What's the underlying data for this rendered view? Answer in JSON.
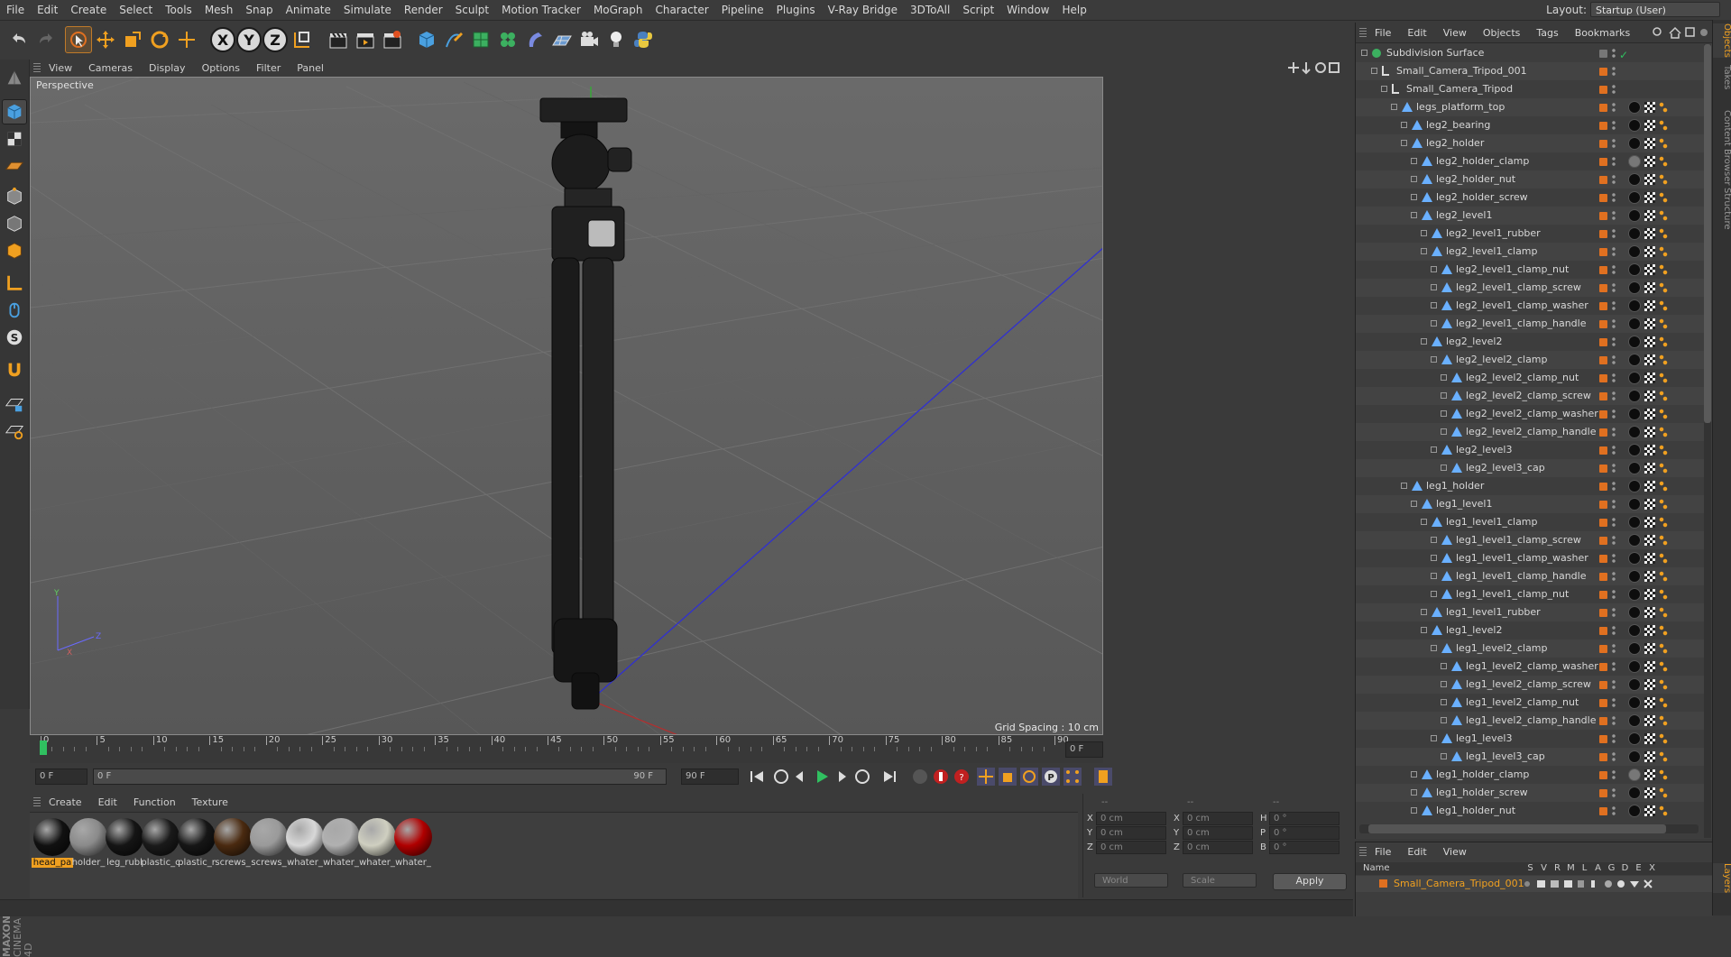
{
  "menubar": {
    "items": [
      "File",
      "Edit",
      "Create",
      "Select",
      "Tools",
      "Mesh",
      "Snap",
      "Animate",
      "Simulate",
      "Render",
      "Sculpt",
      "Motion Tracker",
      "MoGraph",
      "Character",
      "Pipeline",
      "Plugins",
      "V-Ray Bridge",
      "3DToAll",
      "Script",
      "Window",
      "Help"
    ],
    "layout_label": "Layout:",
    "layout_value": "Startup (User)"
  },
  "toolbar": {
    "axis_x": "X",
    "axis_y": "Y",
    "axis_z": "Z"
  },
  "viewport": {
    "menu": [
      "View",
      "Cameras",
      "Display",
      "Options",
      "Filter",
      "Panel"
    ],
    "label": "Perspective",
    "grid_spacing": "Grid Spacing : 10 cm",
    "axis_x": "X",
    "axis_y": "Y",
    "axis_z": "Z"
  },
  "timeline": {
    "ticks": [
      "0",
      "5",
      "10",
      "15",
      "20",
      "25",
      "30",
      "35",
      "40",
      "45",
      "50",
      "55",
      "60",
      "65",
      "70",
      "75",
      "80",
      "85",
      "90"
    ],
    "current_frame": "0 F",
    "start_field": "0 F",
    "range_start": "0 F",
    "range_end": "90 F",
    "end_field": "90 F"
  },
  "materials": {
    "menu": [
      "Create",
      "Edit",
      "Function",
      "Texture"
    ],
    "items": [
      {
        "name": "head_pa",
        "color": "#111111",
        "active": true
      },
      {
        "name": "holder_",
        "color": "#8a8a8a",
        "active": false
      },
      {
        "name": "leg_rubl",
        "color": "#151515",
        "active": false
      },
      {
        "name": "plastic_c",
        "color": "#1a1a1a",
        "active": false
      },
      {
        "name": "plastic_r",
        "color": "#161616",
        "active": false
      },
      {
        "name": "screws_",
        "color": "#4a2a10",
        "active": false
      },
      {
        "name": "screws_",
        "color": "#9a9a9a",
        "active": false
      },
      {
        "name": "whater_",
        "color": "#d8d8d8",
        "active": false
      },
      {
        "name": "whater_",
        "color": "#b0b0b0",
        "active": false
      },
      {
        "name": "whater_",
        "color": "#cfcfc0",
        "active": false
      },
      {
        "name": "whater_",
        "color": "#b00000",
        "active": false
      }
    ]
  },
  "coordinates": {
    "header1": "--",
    "header2": "--",
    "header3": "--",
    "rows": [
      {
        "l1": "X",
        "v1": "0 cm",
        "l2": "X",
        "v2": "0 cm",
        "l3": "H",
        "v3": "0 °"
      },
      {
        "l1": "Y",
        "v1": "0 cm",
        "l2": "Y",
        "v2": "0 cm",
        "l3": "P",
        "v3": "0 °"
      },
      {
        "l1": "Z",
        "v1": "0 cm",
        "l2": "Z",
        "v2": "0 cm",
        "l3": "B",
        "v3": "0 °"
      }
    ],
    "mode": "World",
    "scale": "Scale",
    "apply": "Apply"
  },
  "object_manager": {
    "menu": [
      "File",
      "Edit",
      "View",
      "Objects",
      "Tags",
      "Bookmarks"
    ],
    "objects": [
      {
        "name": "Subdivision Surface",
        "depth": 0,
        "type": "subdiv"
      },
      {
        "name": "Small_Camera_Tripod_001",
        "depth": 1,
        "type": "null"
      },
      {
        "name": "Small_Camera_Tripod",
        "depth": 2,
        "type": "null"
      },
      {
        "name": "legs_platform_top",
        "depth": 3,
        "type": "poly"
      },
      {
        "name": "leg2_bearing",
        "depth": 4,
        "type": "poly"
      },
      {
        "name": "leg2_holder",
        "depth": 4,
        "type": "poly"
      },
      {
        "name": "leg2_holder_clamp",
        "depth": 5,
        "type": "poly"
      },
      {
        "name": "leg2_holder_nut",
        "depth": 5,
        "type": "poly"
      },
      {
        "name": "leg2_holder_screw",
        "depth": 5,
        "type": "poly"
      },
      {
        "name": "leg2_level1",
        "depth": 5,
        "type": "poly"
      },
      {
        "name": "leg2_level1_rubber",
        "depth": 6,
        "type": "poly"
      },
      {
        "name": "leg2_level1_clamp",
        "depth": 6,
        "type": "poly"
      },
      {
        "name": "leg2_level1_clamp_nut",
        "depth": 7,
        "type": "poly"
      },
      {
        "name": "leg2_level1_clamp_screw",
        "depth": 7,
        "type": "poly"
      },
      {
        "name": "leg2_level1_clamp_washer",
        "depth": 7,
        "type": "poly"
      },
      {
        "name": "leg2_level1_clamp_handle",
        "depth": 7,
        "type": "poly"
      },
      {
        "name": "leg2_level2",
        "depth": 6,
        "type": "poly"
      },
      {
        "name": "leg2_level2_clamp",
        "depth": 7,
        "type": "poly"
      },
      {
        "name": "leg2_level2_clamp_nut",
        "depth": 8,
        "type": "poly"
      },
      {
        "name": "leg2_level2_clamp_screw",
        "depth": 8,
        "type": "poly"
      },
      {
        "name": "leg2_level2_clamp_washer",
        "depth": 8,
        "type": "poly"
      },
      {
        "name": "leg2_level2_clamp_handle",
        "depth": 8,
        "type": "poly"
      },
      {
        "name": "leg2_level3",
        "depth": 7,
        "type": "poly"
      },
      {
        "name": "leg2_level3_cap",
        "depth": 8,
        "type": "poly"
      },
      {
        "name": "leg1_holder",
        "depth": 4,
        "type": "poly"
      },
      {
        "name": "leg1_level1",
        "depth": 5,
        "type": "poly"
      },
      {
        "name": "leg1_level1_clamp",
        "depth": 6,
        "type": "poly"
      },
      {
        "name": "leg1_level1_clamp_screw",
        "depth": 7,
        "type": "poly"
      },
      {
        "name": "leg1_level1_clamp_washer",
        "depth": 7,
        "type": "poly"
      },
      {
        "name": "leg1_level1_clamp_handle",
        "depth": 7,
        "type": "poly"
      },
      {
        "name": "leg1_level1_clamp_nut",
        "depth": 7,
        "type": "poly"
      },
      {
        "name": "leg1_level1_rubber",
        "depth": 6,
        "type": "poly"
      },
      {
        "name": "leg1_level2",
        "depth": 6,
        "type": "poly"
      },
      {
        "name": "leg1_level2_clamp",
        "depth": 7,
        "type": "poly"
      },
      {
        "name": "leg1_level2_clamp_washer",
        "depth": 8,
        "type": "poly"
      },
      {
        "name": "leg1_level2_clamp_screw",
        "depth": 8,
        "type": "poly"
      },
      {
        "name": "leg1_level2_clamp_nut",
        "depth": 8,
        "type": "poly"
      },
      {
        "name": "leg1_level2_clamp_handle",
        "depth": 8,
        "type": "poly"
      },
      {
        "name": "leg1_level3",
        "depth": 7,
        "type": "poly"
      },
      {
        "name": "leg1_level3_cap",
        "depth": 8,
        "type": "poly"
      },
      {
        "name": "leg1_holder_clamp",
        "depth": 5,
        "type": "poly"
      },
      {
        "name": "leg1_holder_screw",
        "depth": 5,
        "type": "poly"
      },
      {
        "name": "leg1_holder_nut",
        "depth": 5,
        "type": "poly"
      }
    ]
  },
  "layers": {
    "menu": [
      "File",
      "Edit",
      "View"
    ],
    "header_name": "Name",
    "columns": [
      "S",
      "V",
      "R",
      "M",
      "L",
      "A",
      "G",
      "D",
      "E",
      "X"
    ],
    "row_name": "Small_Camera_Tripod_001"
  },
  "side_tabs": [
    "Objects",
    "Takes",
    "Content Browser",
    "Structure"
  ],
  "side_tab_bottom": "Layers",
  "brand": {
    "line1": "MAXON",
    "line2": "CINEMA 4D"
  },
  "colors": {
    "accent": "#f0a020",
    "layer": "#e07020",
    "background": "#3a3a3a"
  }
}
